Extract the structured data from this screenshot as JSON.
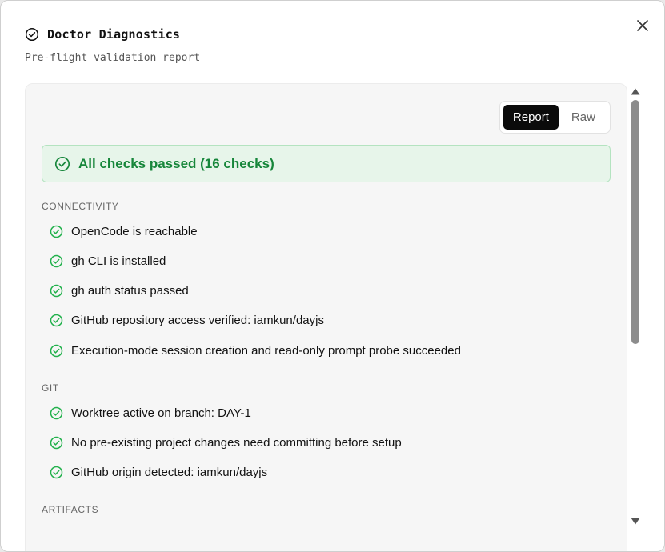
{
  "dialog": {
    "title": "Doctor Diagnostics",
    "subtitle": "Pre-flight validation report",
    "close_icon": "close-icon"
  },
  "view_toggle": {
    "options": [
      "Report",
      "Raw"
    ],
    "selected": "Report"
  },
  "summary": {
    "text": "All checks passed (16 checks)",
    "status_color": "#16863a"
  },
  "sections": [
    {
      "label": "CONNECTIVITY",
      "checks": [
        "OpenCode is reachable",
        "gh CLI is installed",
        "gh auth status passed",
        "GitHub repository access verified: iamkun/dayjs",
        "Execution-mode session creation and read-only prompt probe succeeded"
      ]
    },
    {
      "label": "GIT",
      "checks": [
        "Worktree active on branch: DAY-1",
        "No pre-existing project changes need committing before setup",
        "GitHub origin detected: iamkun/dayjs"
      ]
    },
    {
      "label": "ARTIFACTS",
      "checks": []
    }
  ],
  "colors": {
    "pass_green": "#22b14c",
    "banner_bg": "#e7f5ea",
    "toggle_active": "#0b0b0b"
  }
}
